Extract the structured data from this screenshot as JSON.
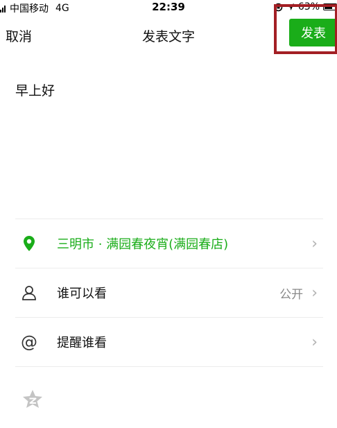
{
  "status_bar": {
    "carrier": "中国移动",
    "network": "4G",
    "time": "22:39",
    "battery": "63%"
  },
  "nav": {
    "cancel_label": "取消",
    "title": "发表文字",
    "publish_label": "发表"
  },
  "post": {
    "text": "早上好"
  },
  "options": {
    "location": {
      "label": "三明市 · 满园春夜宵(满园春店)",
      "icon": "location-pin-icon",
      "color": "#1aad19"
    },
    "visibility": {
      "label": "谁可以看",
      "value": "公开",
      "icon": "person-icon"
    },
    "mention": {
      "label": "提醒谁看",
      "icon": "at-icon"
    }
  },
  "share": {
    "icon": "qzone-star-icon"
  },
  "colors": {
    "accent": "#1aad19",
    "highlight_box": "#a31f24"
  }
}
